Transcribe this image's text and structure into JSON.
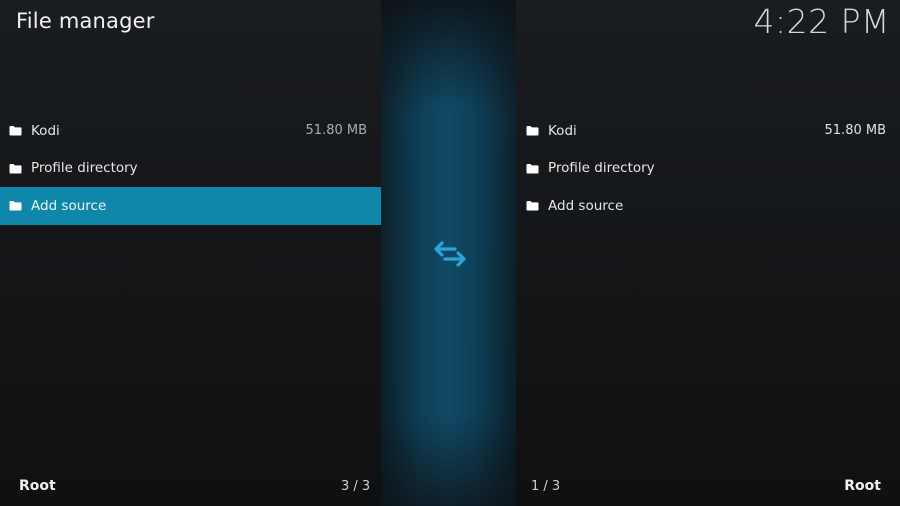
{
  "header": {
    "title": "File manager",
    "clock": "4:22 PM"
  },
  "colors": {
    "accent": "#0f87ab",
    "background": "#131517",
    "center_strip": "#104a66",
    "swap_icon": "#2aa6d6"
  },
  "left_panel": {
    "items": [
      {
        "icon": "folder-icon",
        "label": "Kodi",
        "size": "51.80 MB",
        "selected": false
      },
      {
        "icon": "folder-icon",
        "label": "Profile directory",
        "size": "",
        "selected": false
      },
      {
        "icon": "folder-icon",
        "label": "Add source",
        "size": "",
        "selected": true
      }
    ],
    "footer_label": "Root",
    "footer_count": "3 / 3"
  },
  "right_panel": {
    "items": [
      {
        "icon": "folder-icon",
        "label": "Kodi",
        "size": "51.80 MB",
        "selected": false
      },
      {
        "icon": "folder-icon",
        "label": "Profile directory",
        "size": "",
        "selected": false
      },
      {
        "icon": "folder-icon",
        "label": "Add source",
        "size": "",
        "selected": false
      }
    ],
    "footer_label": "Root",
    "footer_count": "1 / 3"
  },
  "center": {
    "icon": "swap-arrows-icon"
  }
}
